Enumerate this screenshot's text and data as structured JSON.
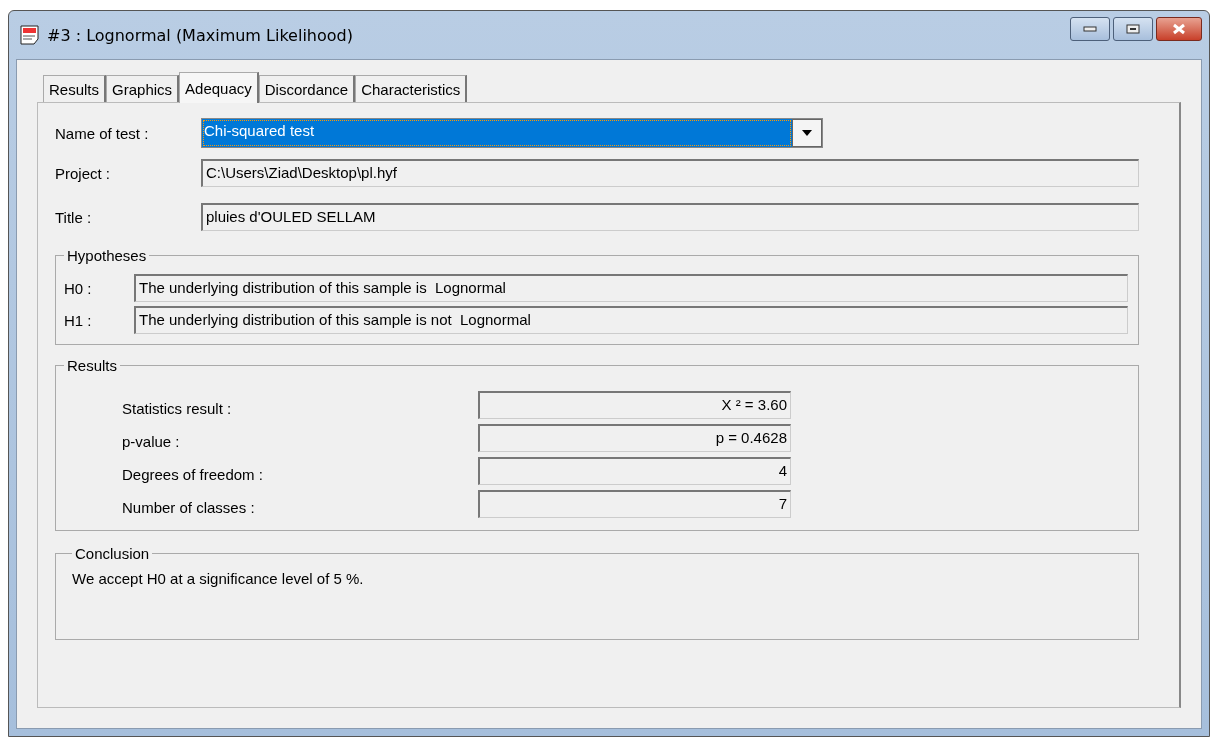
{
  "window": {
    "title": "#3 : Lognormal (Maximum Likelihood)"
  },
  "tabs": [
    {
      "label": "Results",
      "selected": false
    },
    {
      "label": "Graphics",
      "selected": false
    },
    {
      "label": "Adequacy",
      "selected": true
    },
    {
      "label": "Discordance",
      "selected": false
    },
    {
      "label": "Characteristics",
      "selected": false
    }
  ],
  "test": {
    "label": "Name of test :",
    "value": "Chi-squared test"
  },
  "fields": [
    {
      "label": "Project :",
      "value": "C:\\Users\\Ziad\\Desktop\\pl.hyf"
    },
    {
      "label": "Title :",
      "value": "pluies d'OULED SELLAM"
    }
  ],
  "hypotheses": {
    "title": "Hypotheses",
    "items": [
      {
        "label": "H0 :",
        "value": "The underlying distribution of this sample is  Lognormal"
      },
      {
        "label": "H1 :",
        "value": "The underlying distribution of this sample is not  Lognormal"
      }
    ]
  },
  "results": {
    "title": "Results",
    "items": [
      {
        "label": "Statistics result :",
        "value": "X ² = 3.60"
      },
      {
        "label": "p-value :",
        "value": "p = 0.4628"
      },
      {
        "label": "Degrees of freedom :",
        "value": "4"
      },
      {
        "label": "Number of classes :",
        "value": "7"
      }
    ]
  },
  "conclusion": {
    "title": "Conclusion",
    "text": "We accept H0 at a significance level of 5 %."
  }
}
